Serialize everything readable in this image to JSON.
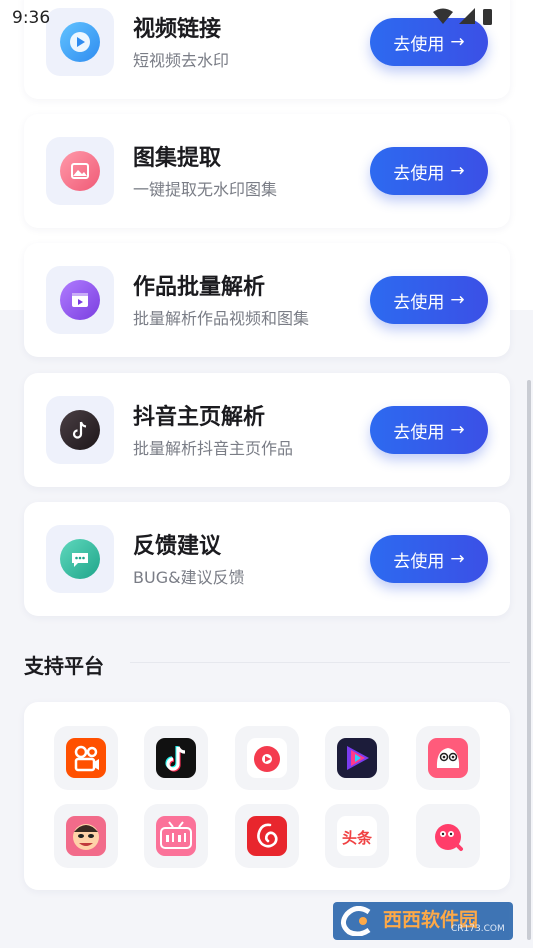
{
  "status_bar": {
    "time": "9:36"
  },
  "features": [
    {
      "title": "视频链接",
      "subtitle": "短视频去水印",
      "button": "去使用",
      "icon": "play-icon",
      "color": "#3aa0f5"
    },
    {
      "title": "图集提取",
      "subtitle": "一键提取无水印图集",
      "button": "去使用",
      "icon": "image-icon",
      "color": "#f46a82"
    },
    {
      "title": "作品批量解析",
      "subtitle": "批量解析作品视频和图集",
      "button": "去使用",
      "icon": "video-icon",
      "color": "#8a4be6"
    },
    {
      "title": "抖音主页解析",
      "subtitle": "批量解析抖音主页作品",
      "button": "去使用",
      "icon": "tiktok-icon",
      "color": "#2a2326"
    },
    {
      "title": "反馈建议",
      "subtitle": "BUG&建议反馈",
      "button": "去使用",
      "icon": "chat-icon",
      "color": "#26b39a"
    }
  ],
  "section": {
    "title": "支持平台"
  },
  "platforms": [
    {
      "name": "kuaishou-logo",
      "color": "#ff5000"
    },
    {
      "name": "douyin-logo",
      "color": "#111111"
    },
    {
      "name": "weishi-logo",
      "color": "#f43b4e"
    },
    {
      "name": "haokan-logo",
      "color": "#1c1c3a"
    },
    {
      "name": "pipixia-logo",
      "color": "#ff5b7b"
    },
    {
      "name": "zuiyou-logo",
      "color": "#f26b8a"
    },
    {
      "name": "bilibili-logo",
      "color": "#fb7299"
    },
    {
      "name": "netease-music-logo",
      "color": "#e8262d"
    },
    {
      "name": "toutiao-logo",
      "color": "#f04142"
    },
    {
      "name": "pipigaoxiao-logo",
      "color": "#ff4a6a"
    }
  ],
  "watermark": {
    "text": "西西软件园",
    "url": "CR173.COM"
  }
}
